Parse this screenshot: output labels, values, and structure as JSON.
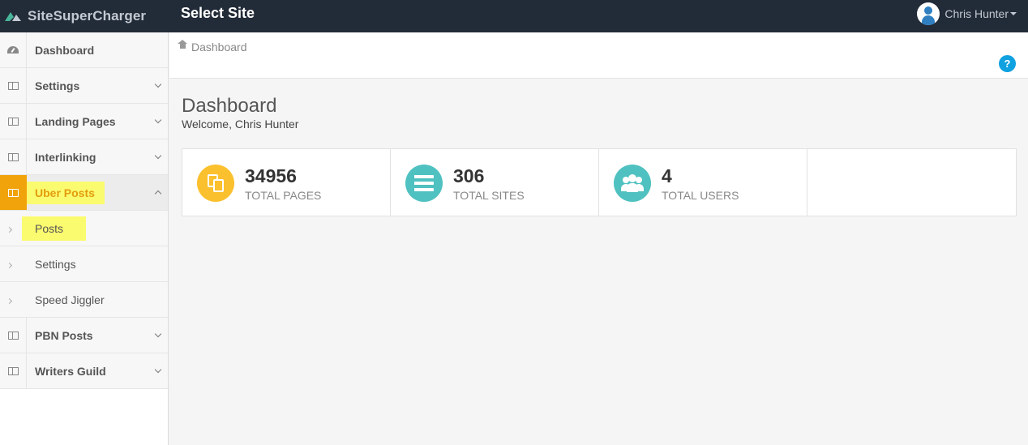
{
  "app": {
    "brand_name": "SiteSuperCharger",
    "site_selector_label": "Select Site"
  },
  "user": {
    "name": "Chris Hunter"
  },
  "sidebar": {
    "items": [
      {
        "label": "Dashboard",
        "icon": "dashboard-gauge-icon"
      },
      {
        "label": "Settings",
        "icon": "book-icon",
        "expandable": true
      },
      {
        "label": "Landing Pages",
        "icon": "book-icon",
        "expandable": true
      },
      {
        "label": "Interlinking",
        "icon": "book-icon",
        "expandable": true
      },
      {
        "label": "Uber Posts",
        "icon": "book-icon",
        "expandable": true,
        "expanded": true,
        "active": true
      },
      {
        "label": "PBN Posts",
        "icon": "book-icon",
        "expandable": true
      },
      {
        "label": "Writers Guild",
        "icon": "book-icon",
        "expandable": true
      }
    ],
    "uber_posts_children": [
      {
        "label": "Posts",
        "highlighted": true
      },
      {
        "label": "Settings"
      },
      {
        "label": "Speed Jiggler"
      }
    ]
  },
  "breadcrumb": {
    "label": "Dashboard"
  },
  "help_label": "?",
  "page": {
    "title": "Dashboard",
    "subtitle": "Welcome, Chris Hunter"
  },
  "stats": [
    {
      "value": "34956",
      "label": "TOTAL PAGES",
      "color": "#fbc02d",
      "icon": "pages-icon"
    },
    {
      "value": "306",
      "label": "TOTAL SITES",
      "color": "#4fc1c0",
      "icon": "list-icon"
    },
    {
      "value": "4",
      "label": "TOTAL USERS",
      "color": "#4fc1c0",
      "icon": "users-icon"
    }
  ],
  "colors": {
    "topbar": "#222b38",
    "accent": "#f0a30a",
    "highlight": "#fbfb70",
    "help": "#0fa1e0"
  }
}
